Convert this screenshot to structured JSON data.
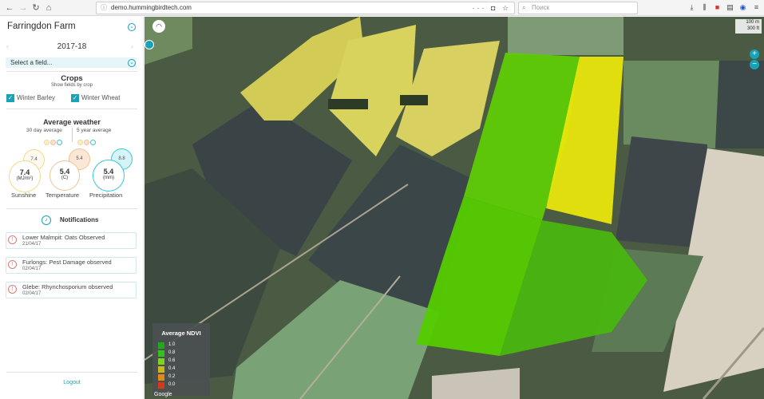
{
  "browser": {
    "url": "demo.hummingbirdtech.com",
    "search_placeholder": "Поиск"
  },
  "sidebar": {
    "farm_name": "Farringdon Farm",
    "season": "2017-18",
    "field_select_placeholder": "Select a field...",
    "crops": {
      "title": "Crops",
      "subtitle": "Show fields by crop",
      "items": [
        {
          "label": "Winter Barley",
          "checked": true
        },
        {
          "label": "Winter Wheat",
          "checked": true
        }
      ]
    },
    "weather": {
      "title": "Average weather",
      "toggle_30": "30 day average",
      "toggle_5y": "5 year average",
      "metrics": [
        {
          "name": "Sunshine",
          "value": "7.4",
          "unit": "(MJ/m²)",
          "avg": "7.4",
          "color": "#f4d98a"
        },
        {
          "name": "Temperature",
          "value": "5.4",
          "unit": "(C)",
          "avg": "5.4",
          "color": "#f0c39a"
        },
        {
          "name": "Precipitation",
          "value": "5.4",
          "unit": "(mm)",
          "avg": "8.8",
          "color": "#36c6dc"
        }
      ]
    },
    "notifications": {
      "title": "Notifications",
      "items": [
        {
          "title": "Lower Malmpit: Oats Observed",
          "date": "21/04/17"
        },
        {
          "title": "Furlongs: Pest Damage observed",
          "date": "02/04/17"
        },
        {
          "title": "Glebe: Rhynchosporium observed",
          "date": "02/04/17"
        }
      ]
    },
    "logout": "Logout"
  },
  "map": {
    "scale_m": "100 m",
    "scale_ft": "300 ft",
    "zoom_in": "+",
    "zoom_out": "−",
    "attribution": "Google",
    "legend": {
      "title": "Average NDVI",
      "levels": [
        {
          "value": "1.0",
          "color": "#1faa1a"
        },
        {
          "value": "0.8",
          "color": "#33c21c"
        },
        {
          "value": "0.6",
          "color": "#7ed321"
        },
        {
          "value": "0.4",
          "color": "#c8b81e"
        },
        {
          "value": "0.2",
          "color": "#e08a1a"
        },
        {
          "value": "0.0",
          "color": "#d43a1a"
        }
      ]
    }
  }
}
